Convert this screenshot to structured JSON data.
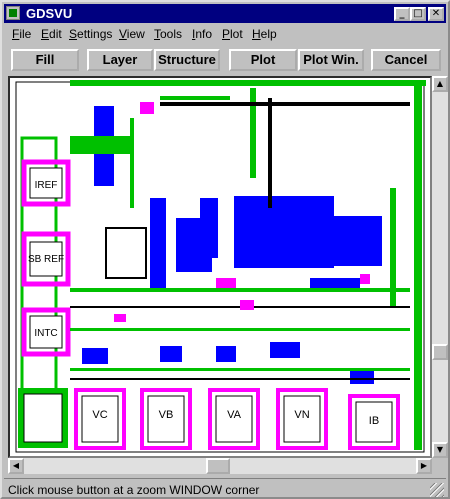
{
  "window": {
    "title": "GDSVU"
  },
  "title_buttons": {
    "minimize": "_",
    "maximize": "□",
    "close": "✕"
  },
  "menu": [
    {
      "label": "File",
      "key": "F",
      "rest": "ile"
    },
    {
      "label": "Edit",
      "key": "E",
      "rest": "dit"
    },
    {
      "label": "Settings",
      "key": "S",
      "rest": "ettings"
    },
    {
      "label": "View",
      "key": "V",
      "rest": "iew"
    },
    {
      "label": "Tools",
      "key": "T",
      "rest": "ools"
    },
    {
      "label": "Info",
      "key": "I",
      "rest": "nfo"
    },
    {
      "label": "Plot",
      "key": "P",
      "rest": "lot"
    },
    {
      "label": "Help",
      "key": "H",
      "rest": "elp"
    }
  ],
  "toolbar": {
    "fill": "Fill",
    "layer": "Layer",
    "structure": "Structure",
    "plot": "Plot",
    "plot_win": "Plot Win.",
    "cancel": "Cancel"
  },
  "layout_labels": {
    "iref": "IREF",
    "sb_ref": "SB REF",
    "intc": "INTC",
    "vc": "VC",
    "vb": "VB",
    "va": "VA",
    "vn": "VN",
    "ib": "IB"
  },
  "colors": {
    "metal1": "#0000ff",
    "metal2": "#00c000",
    "poly": "#ff00ff",
    "contact": "#000000"
  },
  "scrollbars": {
    "up_icon": "up-arrow-icon",
    "down_icon": "down-arrow-icon",
    "left_icon": "left-arrow-icon",
    "right_icon": "right-arrow-icon"
  },
  "status": {
    "text": "Click mouse button at a zoom WINDOW corner"
  }
}
